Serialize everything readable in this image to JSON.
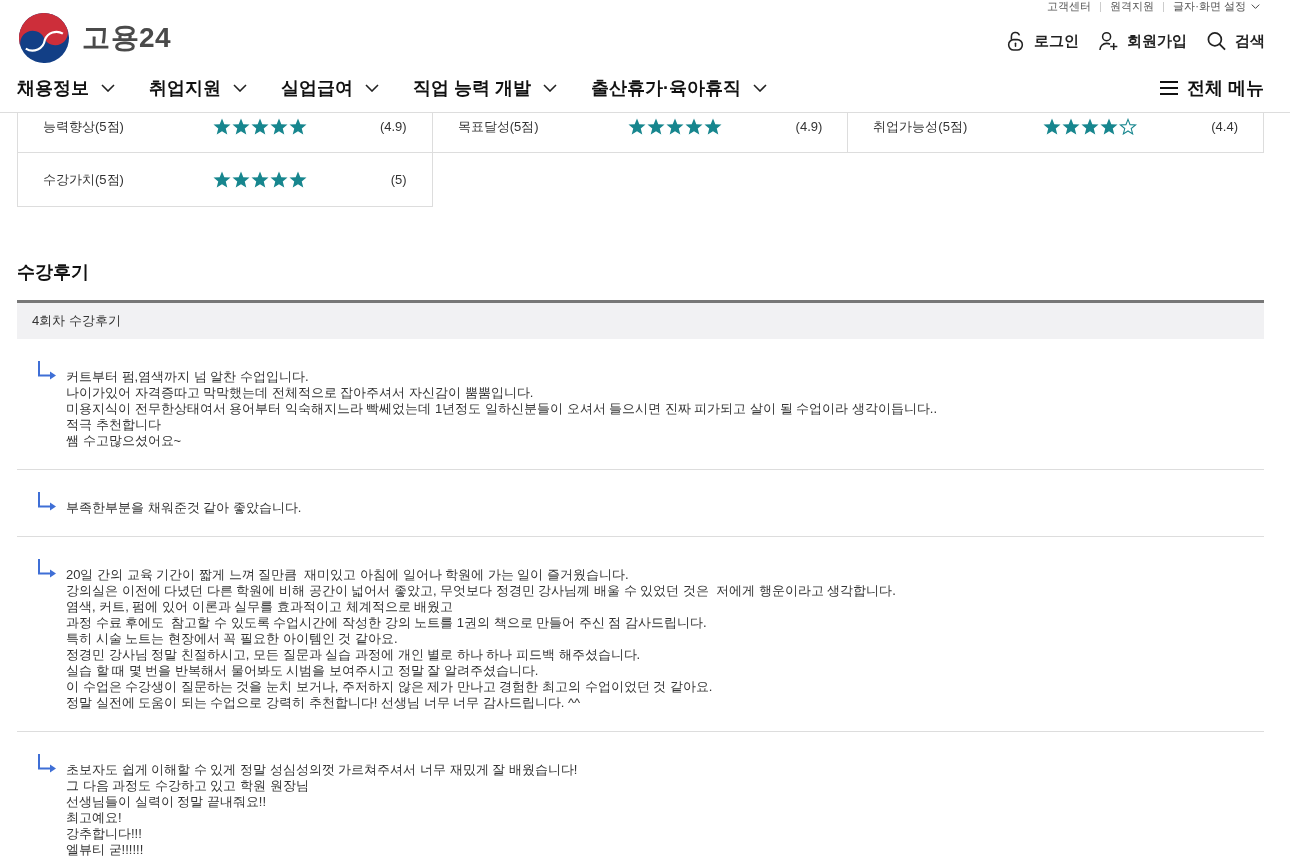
{
  "top_links": [
    {
      "label": "고객센터",
      "dropdown": false
    },
    {
      "label": "원격지원",
      "dropdown": false
    },
    {
      "label": "글자·화면 설정",
      "dropdown": true
    }
  ],
  "site": {
    "name": "고용24"
  },
  "user_links": [
    {
      "kind": "login",
      "label": "로그인"
    },
    {
      "kind": "signup",
      "label": "회원가입"
    },
    {
      "kind": "search",
      "label": "검색"
    }
  ],
  "nav": {
    "items": [
      {
        "label": "채용정보"
      },
      {
        "label": "취업지원"
      },
      {
        "label": "실업급여"
      },
      {
        "label": "직업 능력 개발"
      },
      {
        "label": "출산휴가·육아휴직"
      }
    ],
    "all_menu": {
      "label": "전체 메뉴"
    }
  },
  "ratings": [
    {
      "label": "능력향상(5점)",
      "stars": 5,
      "score": "(4.9)"
    },
    {
      "label": "목표달성(5점)",
      "stars": 5,
      "score": "(4.9)"
    },
    {
      "label": "취업가능성(5점)",
      "stars": 4,
      "score": "(4.4)"
    },
    {
      "label": "수강가치(5점)",
      "stars": 5,
      "score": "(5)"
    }
  ],
  "reviews_section": {
    "title": "수강후기",
    "round_label": "4회차 수강후기",
    "reviews": [
      {
        "lines": [
          "커트부터 펌,염색까지 넘 알찬 수업입니다.",
          "나이가있어 자격증따고 막막했는데 전체적으로 잡아주셔서 자신감이 뿜뿜입니다.",
          "미용지식이 전무한상태여서 용어부터 익숙해지느라 빡쎄었는데 1년정도 일하신분들이 오셔서 들으시면 진짜 피가되고 살이 될 수업이라 생각이듭니다..",
          "적극 추천합니다",
          "쌤 수고많으셨어요~"
        ]
      },
      {
        "lines": [
          "부족한부분을 채워준것 같아 좋았습니다."
        ]
      },
      {
        "lines": [
          "20일 간의 교육 기간이 짧게 느껴 질만큼  재미있고 아침에 일어나 학원에 가는 일이 즐거웠습니다.",
          "강의실은 이전에 다녔던 다른 학원에 비해 공간이 넓어서 좋았고, 무엇보다 정경민 강사님께 배울 수 있었던 것은  저에게 행운이라고 생각합니다.",
          "염색, 커트, 펌에 있어 이론과 실무를 효과적이고 체계적으로 배웠고",
          "과정 수료 후에도  참고할 수 있도록 수업시간에 작성한 강의 노트를 1권의 책으로 만들어 주신 점 감사드립니다.",
          "특히 시술 노트는 현장에서 꼭 필요한 아이템인 것 같아요.",
          "정경민 강사님 정말 친절하시고, 모든 질문과 실습 과정에 개인 별로 하나 하나 피드백 해주셨습니다.",
          "실습 할 때 몇 번을 반복해서 물어봐도 시범을 보여주시고 정말 잘 알려주셨습니다.",
          "이 수업은 수강생이 질문하는 것을 눈치 보거나, 주저하지 않은 제가 만나고 경험한 최고의 수업이었던 것 같아요.",
          "정말 실전에 도움이 되는 수업으로 강력히 추천합니다! 선생님 너무 너무 감사드립니다. ^^"
        ]
      },
      {
        "lines": [
          "초보자도 쉽게 이해할 수 있게 정말 성심성의껏 가르쳐주셔서 너무 재밌게 잘 배웠습니다!",
          "그 다음 과정도 수강하고 있고 학원 원장님",
          "선생님들이 실력이 정말 끝내줘요!!",
          "최고예요!",
          "강추합니다!!!",
          "엘뷰티 굳!!!!!!"
        ]
      }
    ]
  }
}
